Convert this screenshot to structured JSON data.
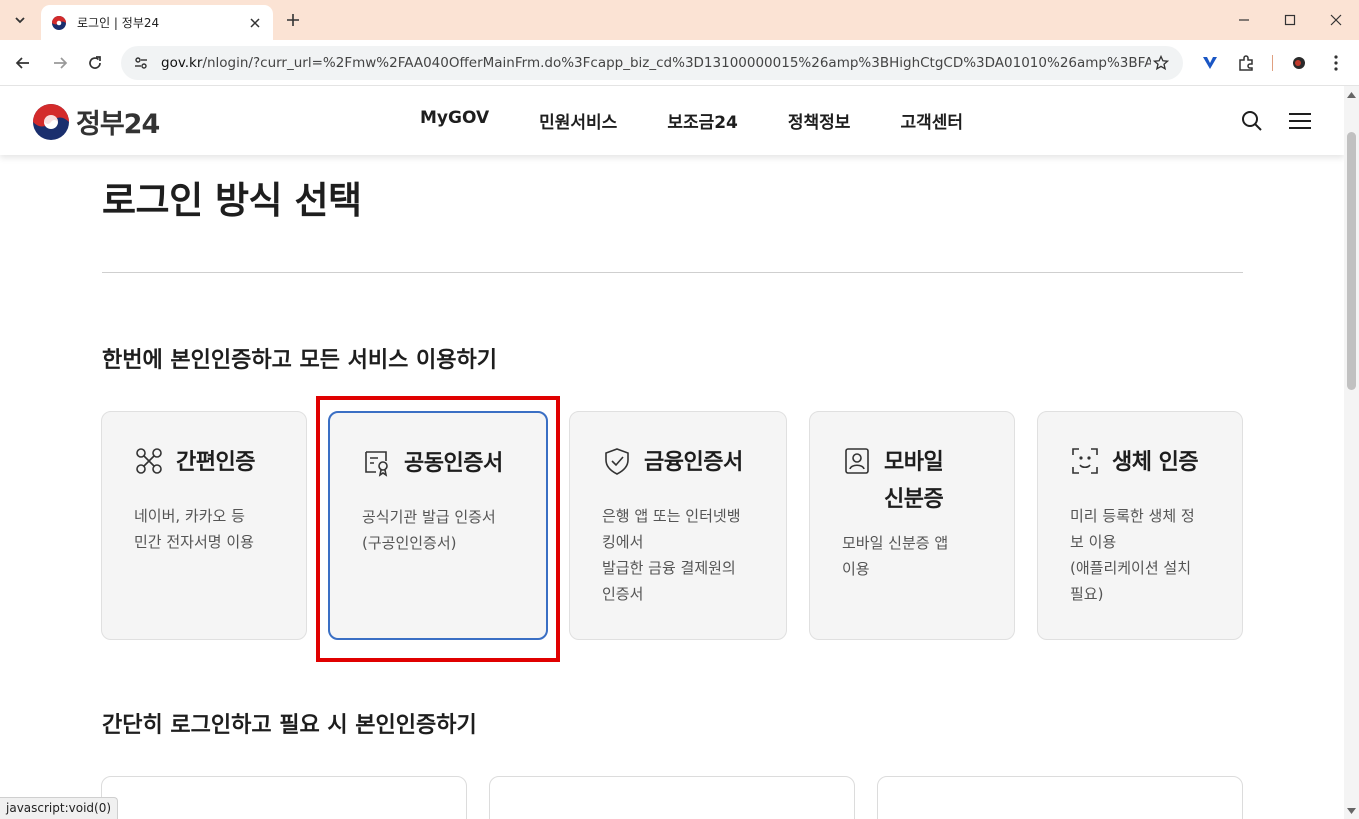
{
  "browser": {
    "tab_title": "로그인 | 정부24",
    "url_host": "gov.kr",
    "url_path": "/nlogin/?curr_url=%2Fmw%2FAA040OfferMainFrm.do%3Fcapp_biz_cd%3D13100000015%26amp%3BHighCtgCD%3DA01010%26amp%3BFAX_TYPE...",
    "status_text": "javascript:void(0)"
  },
  "header": {
    "logo_text": "정부24",
    "nav": [
      "MyGOV",
      "민원서비스",
      "보조금24",
      "정책정보",
      "고객센터"
    ]
  },
  "page": {
    "title": "로그인 방식 선택",
    "section1_title": "한번에 본인인증하고 모든 서비스 이용하기",
    "section2_title": "간단히 로그인하고 필요 시 본인인증하기"
  },
  "cards": [
    {
      "title": "간편인증",
      "desc": "네이버, 카카오 등\n민간 전자서명 이용",
      "icon": "nodes-icon"
    },
    {
      "title": "공동인증서",
      "desc": "공식기관 발급 인증서\n(구공인인증서)",
      "icon": "certificate-icon"
    },
    {
      "title": "금융인증서",
      "desc": "은행 앱 또는 인터넷뱅\n킹에서\n발급한 금융 결제원의\n인증서",
      "icon": "shield-check-icon"
    },
    {
      "title": "모바일\n신분증",
      "desc": "모바일 신분증 앱\n이용",
      "icon": "id-card-icon"
    },
    {
      "title": "생체 인증",
      "desc": "미리 등록한 생체 정\n보 이용\n(애플리케이션 설치\n필요)",
      "icon": "face-scan-icon"
    }
  ],
  "colors": {
    "selected_border": "#3a6fc4",
    "highlight": "#e00000",
    "tabbar_bg": "#fbe3d4"
  }
}
